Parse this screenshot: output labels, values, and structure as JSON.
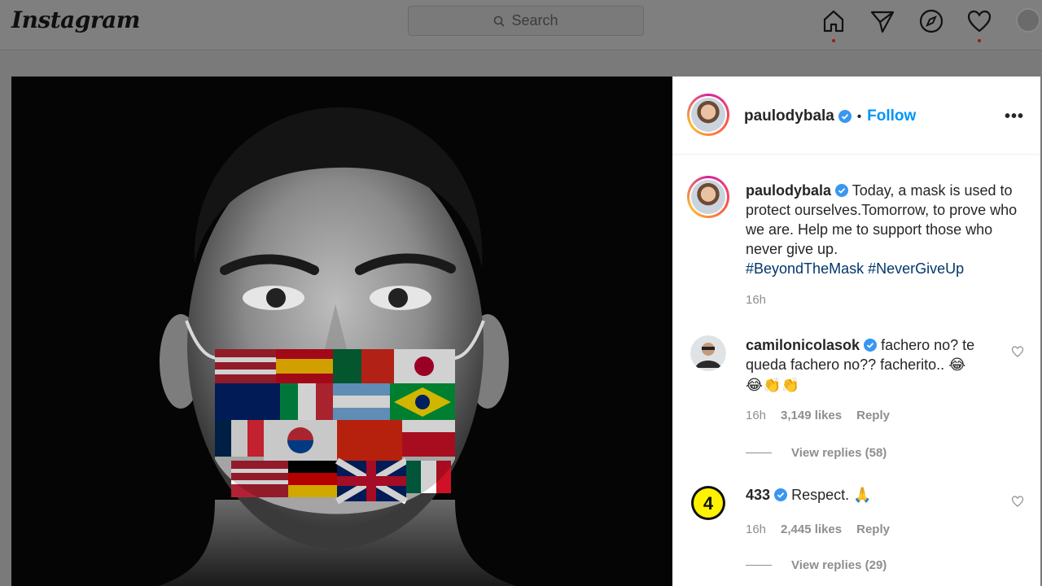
{
  "topbar": {
    "logo": "Instagram",
    "search_placeholder": "Search",
    "icons": [
      "home-icon",
      "direct-icon",
      "explore-icon",
      "activity-icon",
      "profile-avatar"
    ]
  },
  "colors": {
    "link_blue": "#0095f6",
    "hashtag": "#00376b",
    "muted": "#8e8e8e",
    "verified": "#3897f0"
  },
  "post": {
    "author": "paulodybala",
    "follow_label": "Follow",
    "more_label": "•••",
    "caption_author": "paulodybala",
    "caption_line": "Today, a mask is used to protect ourselves.Tomorrow, to prove who we are. Help me to support those who never give up.",
    "hashtag_1": "#BeyondTheMask",
    "hashtag_2": "#NeverGiveUp",
    "time": "16h"
  },
  "comments": [
    {
      "username": "camilonicolasok",
      "text": "fachero no? te queda fachero no?? facherito..",
      "emoji_inline": "😂",
      "emoji_line": "😂👏👏",
      "time": "16h",
      "likes": "3,149 likes",
      "reply_label": "Reply",
      "view_replies": "View replies (58)"
    },
    {
      "username": "433",
      "text": "Respect.",
      "emoji_inline": "🙏",
      "time": "16h",
      "likes": "2,445 likes",
      "reply_label": "Reply",
      "view_replies": "View replies (29)"
    }
  ]
}
